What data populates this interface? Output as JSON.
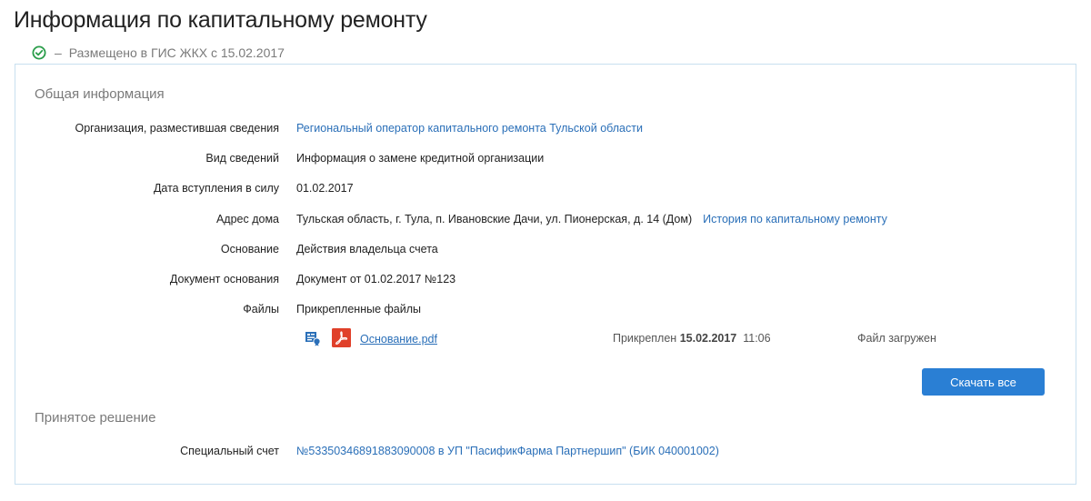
{
  "page": {
    "title": "Информация по капитальному ремонту",
    "status": {
      "dash": "–",
      "text": "Размещено в ГИС ЖКХ с 15.02.2017",
      "color": "#2a9d4a"
    }
  },
  "general": {
    "title": "Общая информация",
    "rows": [
      {
        "label": "Организация, разместившая сведения",
        "value": "Региональный оператор капитального ремонта Тульской области"
      },
      {
        "label": "Вид сведений",
        "value": "Информация о замене кредитной организации"
      },
      {
        "label": "Дата вступления в силу",
        "value": "01.02.2017"
      },
      {
        "label": "Адрес дома",
        "value": "Тульская область, г. Тула, п. Ивановские Дачи, ул. Пионерская, д. 14 (Дом)",
        "link": "История по капитальному ремонту"
      },
      {
        "label": "Основание",
        "value": "Действия владельца счета"
      },
      {
        "label": "Документ основания",
        "value": "Документ от 01.02.2017 №123"
      },
      {
        "label": "Файлы",
        "value": "Прикрепленные файлы"
      }
    ],
    "file": {
      "sig_icon": "signature-icon",
      "type_icon": "pdf-icon",
      "name": "Основание.pdf",
      "attached_label": "Прикреплен",
      "attached_date": "15.02.2017",
      "attached_time": "11:06",
      "status": "Файл загружен"
    },
    "download_all": "Скачать все"
  },
  "decision": {
    "title": "Принятое решение",
    "rows": [
      {
        "label": "Специальный счет",
        "value": "№53350346891883090008 в УП \"ПасификФарма Партнершип\" (БИК 040001002)"
      }
    ]
  },
  "colors": {
    "accent": "#2a7fd4",
    "link": "#2a6fb8",
    "border": "#c8dff0",
    "pdf": "#e0402a"
  }
}
